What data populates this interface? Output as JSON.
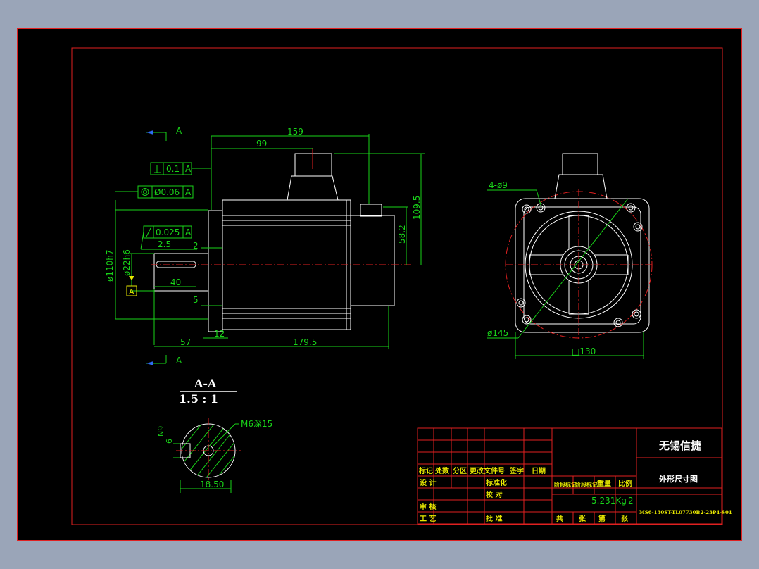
{
  "section": {
    "title": "A-A",
    "scale": "1.5 : 1",
    "tap_note": "M6深15",
    "key_width": "6",
    "key_dim_n": "N9",
    "width_dim": "18.50"
  },
  "side_view": {
    "section_mark_top": "A",
    "section_mark_bottom": "A",
    "dims": {
      "overall_len": "159",
      "flange_to_conn": "99",
      "height_top": "109.5",
      "height_conn": "58.2",
      "flange_dia": "ø110h7",
      "shaft_dia": "ø22h6",
      "shaft_len": "40",
      "key_offset": "2.5",
      "d2": "2",
      "d5": "5",
      "d12": "12",
      "d57": "57",
      "body_len": "179.5"
    },
    "tolerances": {
      "perp": "0.1",
      "perp_ref": "A",
      "conc": "Ø0.06",
      "conc_ref": "A",
      "runout": "0.025",
      "runout_ref": "A"
    },
    "datum": "A"
  },
  "front_view": {
    "holes": "4-ø9",
    "pcd": "ø145",
    "square": "□130"
  },
  "title_block": {
    "company": "无锡信捷",
    "drawing_title": "外形尺寸图",
    "mass": "5.231Kg",
    "scale": "2",
    "part_no": "MS6-130ST-TL07730B2-23P4-S01",
    "hdr": {
      "mark": "标记",
      "count": "处数",
      "zone": "分区",
      "change_doc": "更改文件号",
      "sign": "签字",
      "date": "日期"
    },
    "rows": {
      "design": "设 计",
      "std": "标准化",
      "check": "校 对",
      "review": "审 核",
      "craft": "工 艺",
      "approve": "批 准"
    },
    "stage": {
      "mark_a": "阶段标记",
      "mark_b": "阶段标记",
      "weight": "重量",
      "ratio": "比例"
    },
    "sheet": {
      "total": "共",
      "zhang1": "张",
      "di": "第",
      "zhang2": "张"
    }
  },
  "colors": {
    "background": "#000000",
    "frame": "#e02020",
    "geometry": "#ffffff",
    "dimension": "#19d319",
    "text": "#e8e800"
  }
}
